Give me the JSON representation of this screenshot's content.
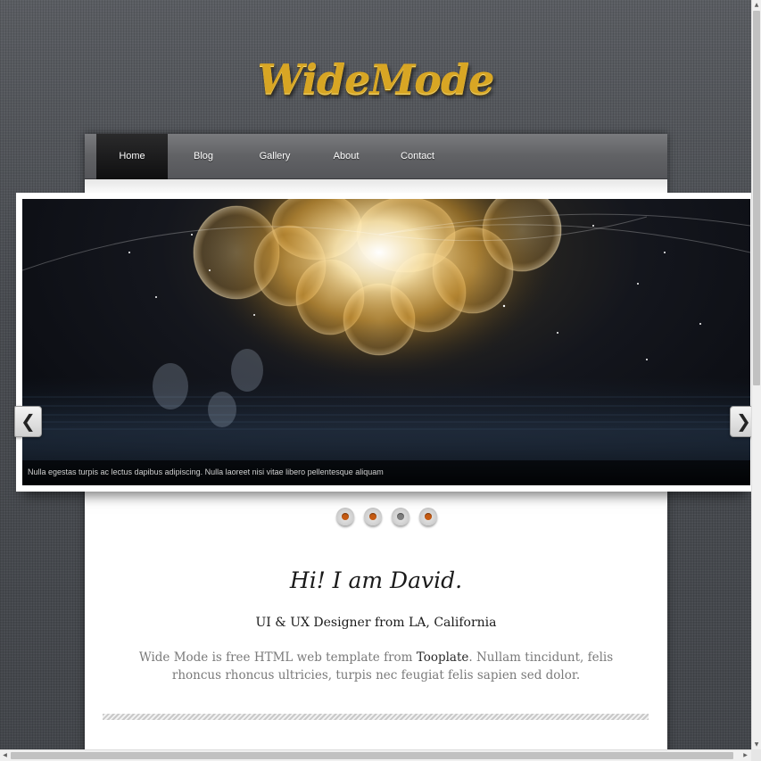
{
  "site": {
    "logo": "WideMode"
  },
  "nav": {
    "items": [
      {
        "label": "Home",
        "active": true
      },
      {
        "label": "Blog",
        "active": false
      },
      {
        "label": "Gallery",
        "active": false
      },
      {
        "label": "About",
        "active": false
      },
      {
        "label": "Contact",
        "active": false
      }
    ]
  },
  "slider": {
    "caption": "Nulla egestas turpis ac lectus dapibus adipiscing. Nulla laoreet nisi vitae libero pellentesque aliquam",
    "prev_icon": "chevron-left-icon",
    "next_icon": "chevron-right-icon",
    "prev_glyph": "❮",
    "next_glyph": "❯",
    "dots": [
      {
        "color": "#c55a12",
        "active": false
      },
      {
        "color": "#c55a12",
        "active": false
      },
      {
        "color": "#7d7d7d",
        "active": true
      },
      {
        "color": "#c55a12",
        "active": false
      }
    ]
  },
  "intro": {
    "heading": "Hi! I am David.",
    "subtitle": "UI & UX Designer from LA, California",
    "desc_before": "Wide Mode is free HTML web template from ",
    "desc_link": "Tooplate",
    "desc_after": ". Nullam tincidunt, felis rhoncus rhoncus ultricies, turpis nec feugiat felis sapien sed dolor."
  },
  "scrollbars": {
    "up": "▲",
    "down": "▼",
    "left": "◀",
    "right": "▶"
  },
  "colors": {
    "background": "#4f5257",
    "logo_gold": "#d8a624",
    "nav": "#616265",
    "nav_active": "#151516",
    "dot_orange": "#c55a12"
  }
}
